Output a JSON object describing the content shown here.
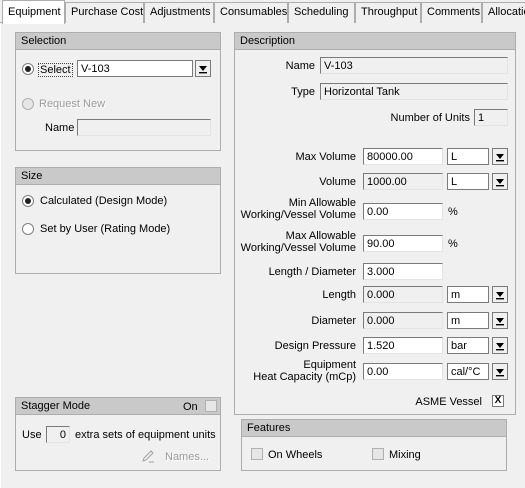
{
  "tabs": [
    {
      "label": "Equipment"
    },
    {
      "label": "Purchase Cost"
    },
    {
      "label": "Adjustments"
    },
    {
      "label": "Consumables"
    },
    {
      "label": "Scheduling"
    },
    {
      "label": "Throughput"
    },
    {
      "label": "Comments"
    },
    {
      "label": "Allocatio"
    }
  ],
  "selection": {
    "title": "Selection",
    "select_label": "Select",
    "select_value": "V-103",
    "request_new_label": "Request New",
    "name_label": "Name",
    "name_value": ""
  },
  "size": {
    "title": "Size",
    "calculated_label": "Calculated (Design Mode)",
    "set_by_user_label": "Set by User (Rating Mode)"
  },
  "stagger": {
    "title": "Stagger Mode",
    "on_label": "On",
    "use_label": "Use",
    "use_value": "0",
    "extra_label": "extra sets of equipment units",
    "names_label": "Names..."
  },
  "description": {
    "title": "Description",
    "name_label": "Name",
    "name_value": "V-103",
    "type_label": "Type",
    "type_value": "Horizontal Tank",
    "units_label": "Number of Units",
    "units_value": "1",
    "max_volume_label": "Max Volume",
    "max_volume_value": "80000.00",
    "max_volume_unit": "L",
    "volume_label": "Volume",
    "volume_value": "1000.00",
    "volume_unit": "L",
    "min_allow_label_1": "Min Allowable",
    "min_allow_label_2": "Working/Vessel Volume",
    "min_allow_value": "0.00",
    "min_allow_unit": "%",
    "max_allow_label_1": "Max Allowable",
    "max_allow_label_2": "Working/Vessel Volume",
    "max_allow_value": "90.00",
    "max_allow_unit": "%",
    "ld_label": "Length / Diameter",
    "ld_value": "3.000",
    "length_label": "Length",
    "length_value": "0.000",
    "length_unit": "m",
    "diameter_label": "Diameter",
    "diameter_value": "0.000",
    "diameter_unit": "m",
    "pressure_label": "Design Pressure",
    "pressure_value": "1.520",
    "pressure_unit": "bar",
    "heatcap_label_1": "Equipment",
    "heatcap_label_2": "Heat Capacity (mCp)",
    "heatcap_value": "0.00",
    "heatcap_unit": "cal/°C",
    "asme_label": "ASME Vessel",
    "asme_checked": "X"
  },
  "features": {
    "title": "Features",
    "wheels_label": "On Wheels",
    "mixing_label": "Mixing"
  }
}
